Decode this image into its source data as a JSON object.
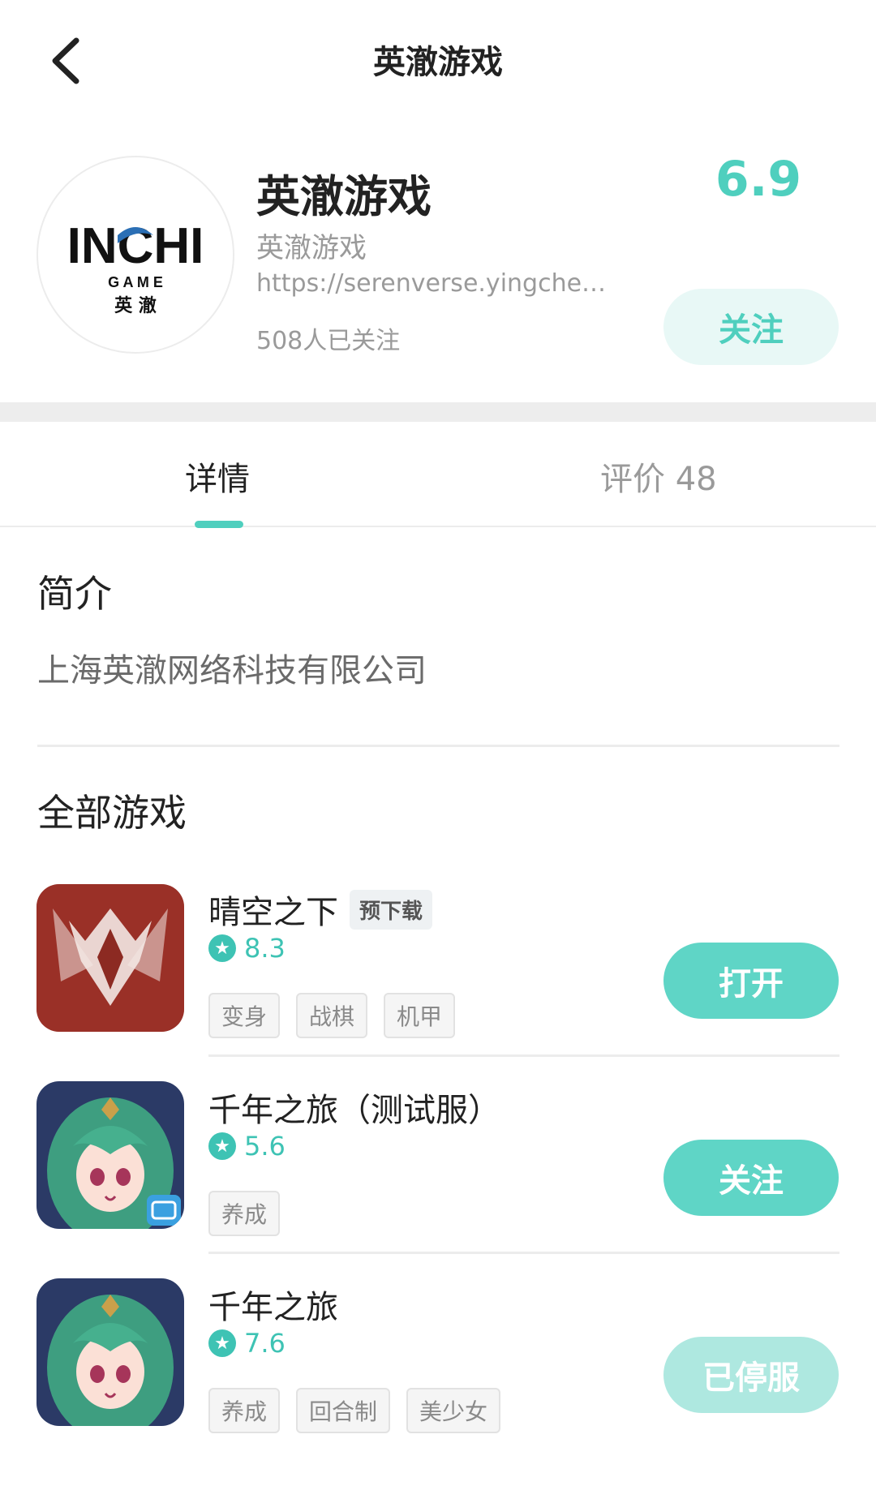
{
  "nav": {
    "title": "英澈游戏"
  },
  "developer": {
    "logo_text_main": "INCHI",
    "logo_text_game": "G A M E",
    "logo_text_cn": "英 澈",
    "name": "英澈游戏",
    "subtitle": "英澈游戏",
    "url": "https://serenverse.yingchenet…",
    "followers": "508人已关注",
    "score": "6.9",
    "follow_label": "关注"
  },
  "tabs": [
    {
      "label": "详情",
      "active": true
    },
    {
      "label": "评价 48",
      "active": false
    }
  ],
  "intro": {
    "title": "简介",
    "text": "上海英澈网络科技有限公司"
  },
  "games_section": {
    "title": "全部游戏",
    "games": [
      {
        "name": "晴空之下",
        "badge": "预下载",
        "rating": "8.3",
        "tags": [
          "变身",
          "战棋",
          "机甲"
        ],
        "action": "打开",
        "icon": "sky-game-icon"
      },
      {
        "name": "千年之旅（测试服）",
        "badge": "",
        "rating": "5.6",
        "tags": [
          "养成"
        ],
        "action": "关注",
        "icon": "green-hair-elf-icon"
      },
      {
        "name": "千年之旅",
        "badge": "",
        "rating": "7.6",
        "tags": [
          "养成",
          "回合制",
          "美少女"
        ],
        "action": "已停服",
        "icon": "green-hair-elf-icon"
      }
    ]
  },
  "colors": {
    "accent": "#4fcfbe",
    "button": "#5fd5c6",
    "button_disabled": "#aee8e0",
    "follow_bg": "#e8f8f6"
  }
}
